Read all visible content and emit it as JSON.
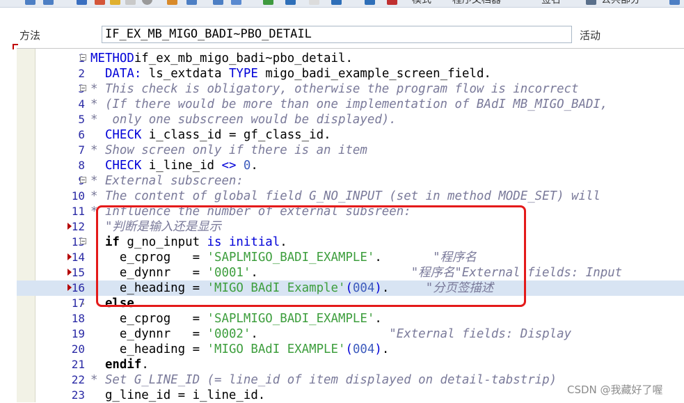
{
  "toolbar": {
    "items": [
      "模式",
      "程序文档器",
      "签名",
      "公共部分"
    ]
  },
  "header": {
    "method_label": "方法",
    "method_value": "IF_EX_MB_MIGO_BADI~PBO_DETAIL",
    "status_label": "活动"
  },
  "editor": {
    "lines": [
      {
        "n": "1",
        "parts": [
          [
            "kw",
            "METHOD"
          ],
          [
            "",
            "if_ex_mb_migo_badi~pbo_detail."
          ]
        ]
      },
      {
        "n": "2",
        "parts": [
          [
            "",
            "  "
          ],
          [
            "kw",
            "DATA:"
          ],
          [
            "",
            " ls_extdata "
          ],
          [
            "kw",
            "TYPE"
          ],
          [
            "",
            " migo_badi_example_screen_field."
          ]
        ]
      },
      {
        "n": "3",
        "parts": [
          [
            "cmt",
            "* This check is obligatory, otherwise the program flow is incorrect"
          ]
        ]
      },
      {
        "n": "4",
        "parts": [
          [
            "cmt",
            "* (If there would be more than one implementation of BAdI MB_MIGO_BADI,"
          ]
        ]
      },
      {
        "n": "5",
        "parts": [
          [
            "cmt",
            "*  only one subscreen would be displayed)."
          ]
        ]
      },
      {
        "n": "6",
        "parts": [
          [
            "",
            "  "
          ],
          [
            "kw",
            "CHECK"
          ],
          [
            "",
            " i_class_id = gf_class_id."
          ]
        ]
      },
      {
        "n": "7",
        "parts": [
          [
            "cmt",
            "* Show screen only if there is an item"
          ]
        ]
      },
      {
        "n": "8",
        "parts": [
          [
            "",
            "  "
          ],
          [
            "kw",
            "CHECK"
          ],
          [
            "",
            " i_line_id "
          ],
          [
            "kw",
            "<>"
          ],
          [
            "",
            " "
          ],
          [
            "num",
            "0"
          ],
          [
            "",
            "."
          ]
        ]
      },
      {
        "n": "9",
        "parts": [
          [
            "cmt",
            "* External subscreen:"
          ]
        ]
      },
      {
        "n": "10",
        "parts": [
          [
            "cmt",
            "* The content of global field G_NO_INPUT (set in method MODE_SET) will"
          ]
        ]
      },
      {
        "n": "11",
        "parts": [
          [
            "cmt",
            "* influence the number of external subsreen:"
          ]
        ]
      },
      {
        "n": "12",
        "parts": [
          [
            "cmt",
            "  \"判断是输入还是显示"
          ]
        ]
      },
      {
        "n": "13",
        "parts": [
          [
            "",
            "  "
          ],
          [
            "kwb",
            "if"
          ],
          [
            "",
            " g_no_input "
          ],
          [
            "kw",
            "is initial"
          ],
          [
            "",
            "."
          ]
        ]
      },
      {
        "n": "14",
        "parts": [
          [
            "",
            "    e_cprog   = "
          ],
          [
            "str",
            "'SAPLMIGO_BADI_EXAMPLE'"
          ],
          [
            "",
            ".       "
          ],
          [
            "cmt",
            "\"程序名"
          ]
        ]
      },
      {
        "n": "15",
        "parts": [
          [
            "",
            "    e_dynnr   = "
          ],
          [
            "str",
            "'0001'"
          ],
          [
            "",
            ".                     "
          ],
          [
            "cmt",
            "\"程序名\"External fields: Input"
          ]
        ]
      },
      {
        "n": "16",
        "parts": [
          [
            "",
            "    e_heading = "
          ],
          [
            "str",
            "'MIGO BAdI Example'"
          ],
          [
            "kw",
            "("
          ],
          [
            "num",
            "004"
          ],
          [
            "kw",
            ")"
          ],
          [
            "",
            ".     "
          ],
          [
            "cmt",
            "\"分页签描述"
          ]
        ]
      },
      {
        "n": "17",
        "parts": [
          [
            "",
            "  "
          ],
          [
            "kwb",
            "else"
          ],
          [
            "",
            "."
          ]
        ]
      },
      {
        "n": "18",
        "parts": [
          [
            "",
            "    e_cprog   = "
          ],
          [
            "str",
            "'SAPLMIGO_BADI_EXAMPLE'"
          ],
          [
            "",
            "."
          ]
        ]
      },
      {
        "n": "19",
        "parts": [
          [
            "",
            "    e_dynnr   = "
          ],
          [
            "str",
            "'0002'"
          ],
          [
            "",
            ".                  "
          ],
          [
            "cmt",
            "\"External fields: Display"
          ]
        ]
      },
      {
        "n": "20",
        "parts": [
          [
            "",
            "    e_heading = "
          ],
          [
            "str",
            "'MIGO BAdI EXAMPLE'"
          ],
          [
            "kw",
            "("
          ],
          [
            "num",
            "004"
          ],
          [
            "kw",
            ")"
          ],
          [
            "",
            "."
          ]
        ]
      },
      {
        "n": "21",
        "parts": [
          [
            "",
            "  "
          ],
          [
            "kwb",
            "endif"
          ],
          [
            "",
            "."
          ]
        ]
      },
      {
        "n": "22",
        "parts": [
          [
            "cmt",
            "* Set G_LINE_ID (= line_id of item displayed on detail-tabstrip)"
          ]
        ]
      },
      {
        "n": "23",
        "parts": [
          [
            "",
            "  g_line_id = i_line_id."
          ]
        ]
      }
    ]
  },
  "watermark": "CSDN @我藏好了喔",
  "colors": {
    "keyword": "#0000d8",
    "string": "#3d9e3d",
    "number": "#3d5bbd",
    "comment": "#7a7a9a",
    "line_number": "#2a2aa5",
    "highlight_line": "#d8e4f3",
    "annotation_box": "#e41a1a"
  }
}
